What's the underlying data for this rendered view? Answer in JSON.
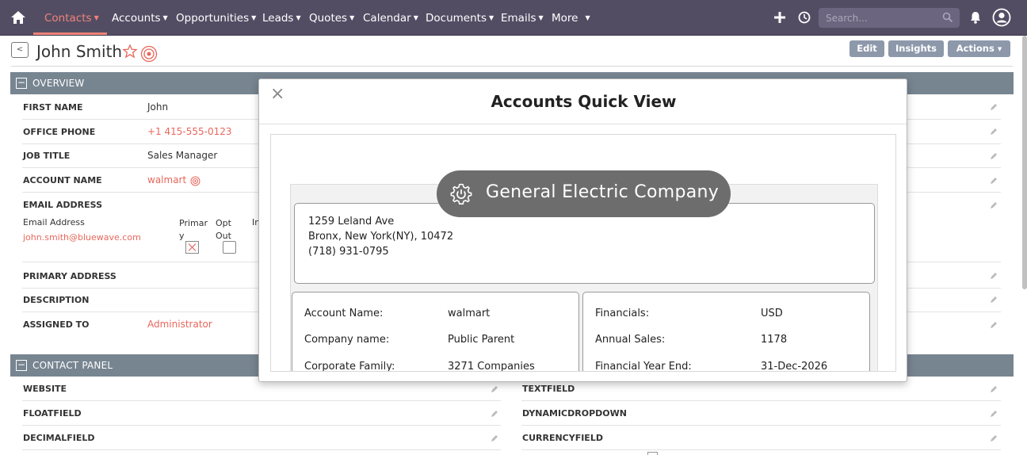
{
  "nav": {
    "items": [
      {
        "label": "Contacts"
      },
      {
        "label": "Accounts"
      },
      {
        "label": "Opportunities"
      },
      {
        "label": "Leads"
      },
      {
        "label": "Quotes"
      },
      {
        "label": "Calendar"
      },
      {
        "label": "Documents"
      },
      {
        "label": "Emails"
      },
      {
        "label": "More"
      }
    ],
    "search_placeholder": "Search...",
    "colors": {
      "bar": "#534d64",
      "active": "#f08377"
    }
  },
  "header": {
    "title": "John Smith",
    "back_label": "<",
    "buttons": {
      "edit": "Edit",
      "insights": "Insights",
      "actions": "Actions"
    }
  },
  "overview": {
    "title": "OVERVIEW",
    "toggle": "−",
    "first_name_label": "FIRST NAME",
    "first_name": "John",
    "office_phone_label": "OFFICE PHONE",
    "office_phone": "+1 415-555-0123",
    "job_title_label": "JOB TITLE",
    "job_title": "Sales Manager",
    "account_name_label": "ACCOUNT NAME",
    "account_name": "walmart",
    "email_label": "EMAIL ADDRESS",
    "email_col_address": "Email Address",
    "email_col_primary": "Primar y",
    "email_col_primary_1": "Primar",
    "email_col_primary_2": "y",
    "email_col_optout_1": "Opt",
    "email_col_optout_2": "Out",
    "email_col_invalid": "In",
    "email_value": "john.smith@bluewave.com",
    "primary_address_label": "PRIMARY ADDRESS",
    "description_label": "DESCRIPTION",
    "assigned_label": "ASSIGNED TO",
    "assigned_to": "Administrator"
  },
  "contact_panel": {
    "title": "CONTACT PANEL",
    "toggle": "−",
    "left_fields": [
      "WEBSITE",
      "FLOATFIELD",
      "DECIMALFIELD"
    ],
    "right_fields": [
      "TEXTFIELD",
      "DYNAMICDROPDOWN",
      "CURRENCYFIELD"
    ]
  },
  "modal": {
    "close": "×",
    "title": "Accounts Quick View",
    "company": "General Electric Company",
    "address_line1": "1259 Leland Ave",
    "address_line2": "Bronx, New York(NY), 10472",
    "phone": "(718) 931-0795",
    "left": [
      {
        "label": "Account Name:",
        "value": "walmart"
      },
      {
        "label": "Company name:",
        "value": "Public Parent"
      },
      {
        "label": "Corporate Family:",
        "value": "3271 Companies"
      }
    ],
    "right": [
      {
        "label": "Financials:",
        "value": "USD"
      },
      {
        "label": "Annual Sales:",
        "value": "1178"
      },
      {
        "label": "Financial Year End:",
        "value": "31-Dec-2026"
      }
    ]
  }
}
